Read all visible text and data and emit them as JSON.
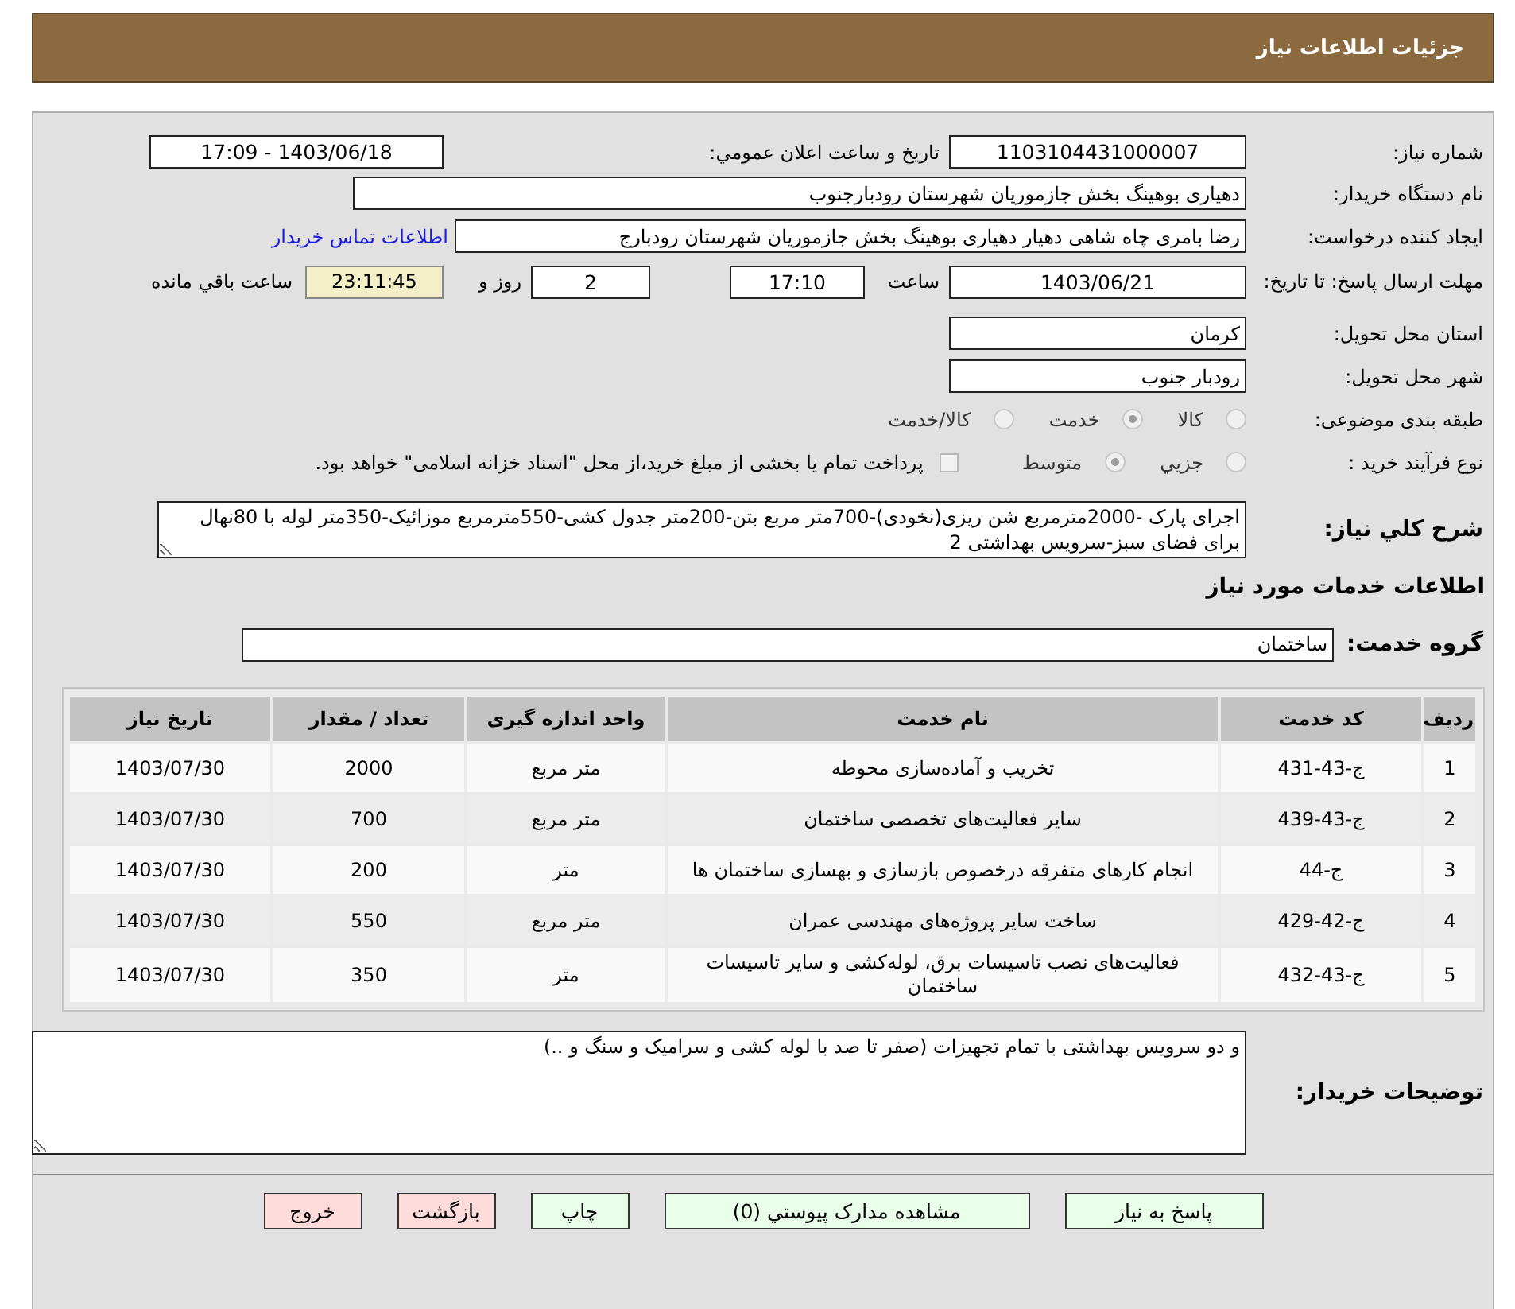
{
  "header": {
    "title": "جزئیات اطلاعات نیاز"
  },
  "need_number": {
    "label": "شماره نیاز:",
    "value": "1103104431000007"
  },
  "announce": {
    "label": "تاریخ و ساعت اعلان عمومي:",
    "value": "1403/06/18 - 17:09"
  },
  "buyer_org": {
    "label": "نام دستگاه خریدار:",
    "value": "دهیاری بوهینگ بخش جازموریان شهرستان رودبارجنوب"
  },
  "requester": {
    "label": "ایجاد کننده درخواست:",
    "value": "رضا بامری چاه شاهی دهیار دهیاری بوهینگ بخش جازموریان شهرستان رودبارج",
    "link": "اطلاعات تماس خریدار"
  },
  "deadline": {
    "label": "مهلت ارسال پاسخ: تا تاریخ:",
    "date": "1403/06/21",
    "time_label": "ساعت",
    "time": "17:10",
    "days": "2",
    "days_label": "روز و",
    "remaining": "23:11:45",
    "remaining_label": "ساعت باقي مانده"
  },
  "province": {
    "label": "استان محل تحویل:",
    "value": "کرمان"
  },
  "city": {
    "label": "شهر محل تحویل:",
    "value": "رودبار جنوب"
  },
  "category": {
    "label": "طبقه بندی موضوعی:",
    "options": [
      {
        "label": "کالا",
        "selected": false
      },
      {
        "label": "خدمت",
        "selected": true
      },
      {
        "label": "کالا/خدمت",
        "selected": false
      }
    ]
  },
  "process": {
    "label": "نوع فرآیند خرید :",
    "options": [
      {
        "label": "جزيي",
        "selected": false
      },
      {
        "label": "متوسط",
        "selected": true
      }
    ],
    "treasury": {
      "checked": false,
      "label": "پرداخت تمام یا بخشی از مبلغ خرید،از محل \"اسناد خزانه اسلامی\" خواهد بود."
    }
  },
  "description": {
    "label": "شرح کلي نیاز:",
    "value": "اجرای پارک -2000مترمربع شن ریزی(نخودی)-700متر مربع بتن-200متر جدول کشی-550مترمربع موزائیک-350متر لوله با 80نهال برای فضای سبز-سرویس بهداشتی 2"
  },
  "services_heading": "اطلاعات خدمات مورد نیاز",
  "service_group": {
    "label": "گروه خدمت:",
    "value": "ساختمان"
  },
  "table": {
    "columns": [
      "ردیف",
      "کد خدمت",
      "نام خدمت",
      "واحد اندازه گیری",
      "تعداد / مقدار",
      "تاریخ نیاز"
    ],
    "rows": [
      [
        "1",
        "ج-43-431",
        "تخریب و آماده‌سازی محوطه",
        "متر مربع",
        "2000",
        "1403/07/30"
      ],
      [
        "2",
        "ج-43-439",
        "سایر فعالیت‌های تخصصی ساختمان",
        "متر مربع",
        "700",
        "1403/07/30"
      ],
      [
        "3",
        "ج-44",
        "انجام کارهای متفرقه درخصوص بازسازی و بهسازی ساختمان ها",
        "متر",
        "200",
        "1403/07/30"
      ],
      [
        "4",
        "ج-42-429",
        "ساخت سایر پروژه‌های مهندسی عمران",
        "متر مربع",
        "550",
        "1403/07/30"
      ],
      [
        "5",
        "ج-43-432",
        "فعالیت‌های نصب تاسیسات برق، لوله‌کشی و سایر تاسیسات ساختمان",
        "متر",
        "350",
        "1403/07/30"
      ]
    ]
  },
  "buyer_notes": {
    "label": "توضیحات خریدار:",
    "value": "و دو سرویس بهداشتی با تمام تجهیزات (صفر تا صد با لوله کشی و سرامیک و سنگ و ..)"
  },
  "buttons": [
    {
      "label": "پاسخ به نیاز",
      "kind": "action"
    },
    {
      "label": "مشاهده مدارک پیوستي (0)",
      "kind": "action"
    },
    {
      "label": "چاپ",
      "kind": "action"
    },
    {
      "label": "بازگشت",
      "kind": "exit"
    },
    {
      "label": "خروج",
      "kind": "exit"
    }
  ]
}
